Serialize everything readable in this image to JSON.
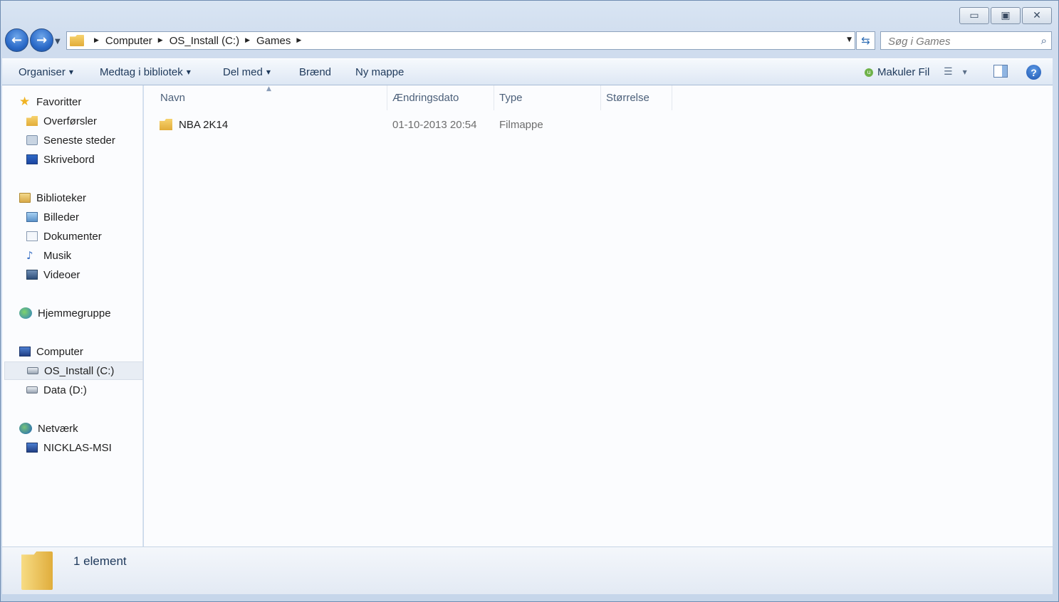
{
  "window": {
    "controls": {
      "minimize": "▭",
      "maximize": "▣",
      "close": "✕"
    }
  },
  "nav": {
    "back_icon": "back-arrow-icon",
    "forward_icon": "forward-arrow-icon",
    "breadcrumbs": [
      "Computer",
      "OS_Install (C:)",
      "Games"
    ],
    "search_placeholder": "Søg i Games"
  },
  "toolbar": {
    "organize": "Organiser",
    "include_library": "Medtag i bibliotek",
    "share_with": "Del med",
    "burn": "Brænd",
    "new_folder": "Ny mappe",
    "makuler": "Makuler Fil"
  },
  "sidebar": {
    "favorites": {
      "label": "Favoritter",
      "items": [
        "Overførsler",
        "Seneste steder",
        "Skrivebord"
      ]
    },
    "libraries": {
      "label": "Biblioteker",
      "items": [
        "Billeder",
        "Dokumenter",
        "Musik",
        "Videoer"
      ]
    },
    "homegroup": "Hjemmegruppe",
    "computer": {
      "label": "Computer",
      "items": [
        "OS_Install (C:)",
        "Data (D:)"
      ],
      "selected": "OS_Install (C:)"
    },
    "network": {
      "label": "Netværk",
      "items": [
        "NICKLAS-MSI"
      ]
    }
  },
  "columns": [
    "Navn",
    "Ændringsdato",
    "Type",
    "Størrelse"
  ],
  "files": [
    {
      "name": "NBA 2K14",
      "date": "01-10-2013 20:54",
      "type": "Filmappe",
      "size": ""
    }
  ],
  "status": {
    "count": "1 element"
  },
  "colors": {
    "accent": "#1e395b",
    "folder": "#e2ac39",
    "chrome": "#cfdcee"
  }
}
